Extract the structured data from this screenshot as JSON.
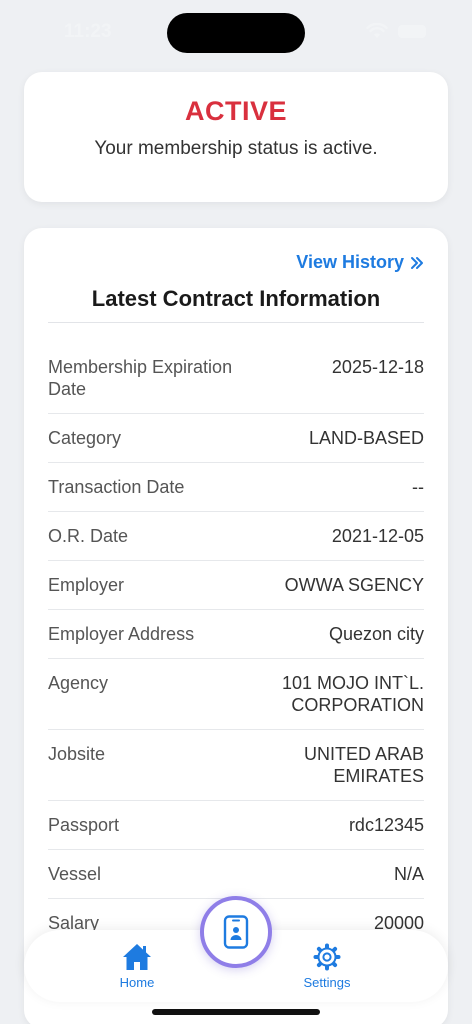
{
  "status_bar": {
    "time": "11:23"
  },
  "membership": {
    "status": "ACTIVE",
    "description": "Your membership status is active."
  },
  "contract": {
    "view_history_label": "View History",
    "title": "Latest Contract Information",
    "rows": [
      {
        "label": "Membership Expiration Date",
        "value": "2025-12-18"
      },
      {
        "label": "Category",
        "value": "LAND-BASED"
      },
      {
        "label": "Transaction Date",
        "value": "--"
      },
      {
        "label": "O.R. Date",
        "value": "2021-12-05"
      },
      {
        "label": "Employer",
        "value": "OWWA SGENCY"
      },
      {
        "label": "Employer Address",
        "value": "Quezon city"
      },
      {
        "label": "Agency",
        "value": "101 MOJO INT`L. CORPORATION"
      },
      {
        "label": "Jobsite",
        "value": "UNITED ARAB EMIRATES"
      },
      {
        "label": "Passport",
        "value": "rdc12345"
      },
      {
        "label": "Vessel",
        "value": "N/A"
      },
      {
        "label": "Salary",
        "value": "20000"
      }
    ]
  },
  "nav": {
    "home_label": "Home",
    "settings_label": "Settings"
  },
  "icons": {
    "home": "home-icon",
    "settings": "gear-icon",
    "center": "phone-id-icon",
    "view_history": "double-chevron-right-icon"
  },
  "colors": {
    "accent": "#1e7be0",
    "status_active": "#d9303e",
    "center_ring": "#8f7ee8",
    "background": "#eef0f3"
  }
}
